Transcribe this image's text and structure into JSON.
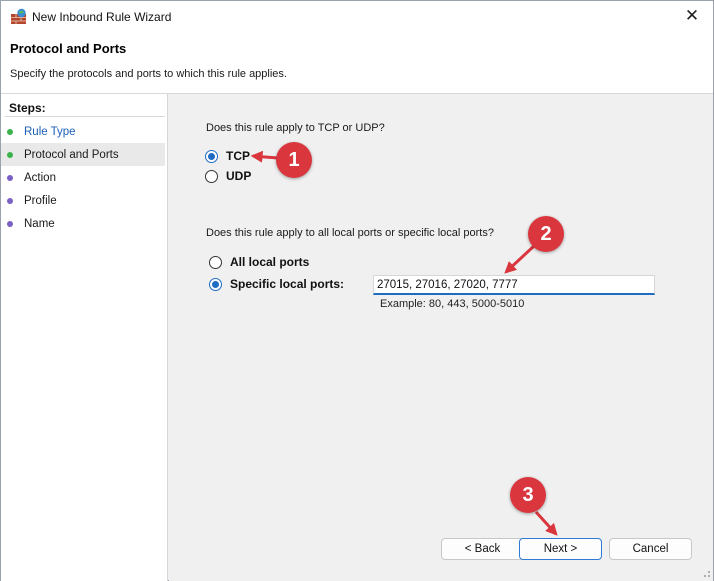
{
  "window": {
    "title": "New Inbound Rule Wizard",
    "close_glyph": "✕"
  },
  "header": {
    "title": "Protocol and Ports",
    "subtitle": "Specify the protocols and ports to which this rule applies."
  },
  "sidebar": {
    "title": "Steps:",
    "items": [
      {
        "label": "Rule Type",
        "state": "done",
        "dot_color": "#3bb34a",
        "text_color": "#1d5fb8"
      },
      {
        "label": "Protocol and Ports",
        "state": "current",
        "dot_color": "#3bb34a",
        "text_color": "#1a1a1a"
      },
      {
        "label": "Action",
        "state": "pending",
        "dot_color": "#7a5fc4",
        "text_color": "#1a1a1a"
      },
      {
        "label": "Profile",
        "state": "pending",
        "dot_color": "#7a5fc4",
        "text_color": "#1a1a1a"
      },
      {
        "label": "Name",
        "state": "pending",
        "dot_color": "#7a5fc4",
        "text_color": "#1a1a1a"
      }
    ]
  },
  "protocol": {
    "question": "Does this rule apply to TCP or UDP?",
    "options": [
      {
        "label": "TCP",
        "selected": true
      },
      {
        "label": "UDP",
        "selected": false
      }
    ]
  },
  "ports": {
    "question": "Does this rule apply to all local ports or specific local ports?",
    "options": [
      {
        "label": "All local ports",
        "selected": false
      },
      {
        "label": "Specific local ports:",
        "selected": true
      }
    ],
    "value": "27015, 27016, 27020, 7777",
    "example": "Example: 80, 443, 5000-5010"
  },
  "buttons": {
    "back": "< Back",
    "next": "Next >",
    "cancel": "Cancel"
  },
  "annotations": {
    "color": "#d9363e",
    "labels": [
      "1",
      "2",
      "3"
    ]
  },
  "colors": {
    "accent": "#1e6cc4",
    "header_bg": "#ffffff",
    "content_bg": "#f0f0f0"
  }
}
